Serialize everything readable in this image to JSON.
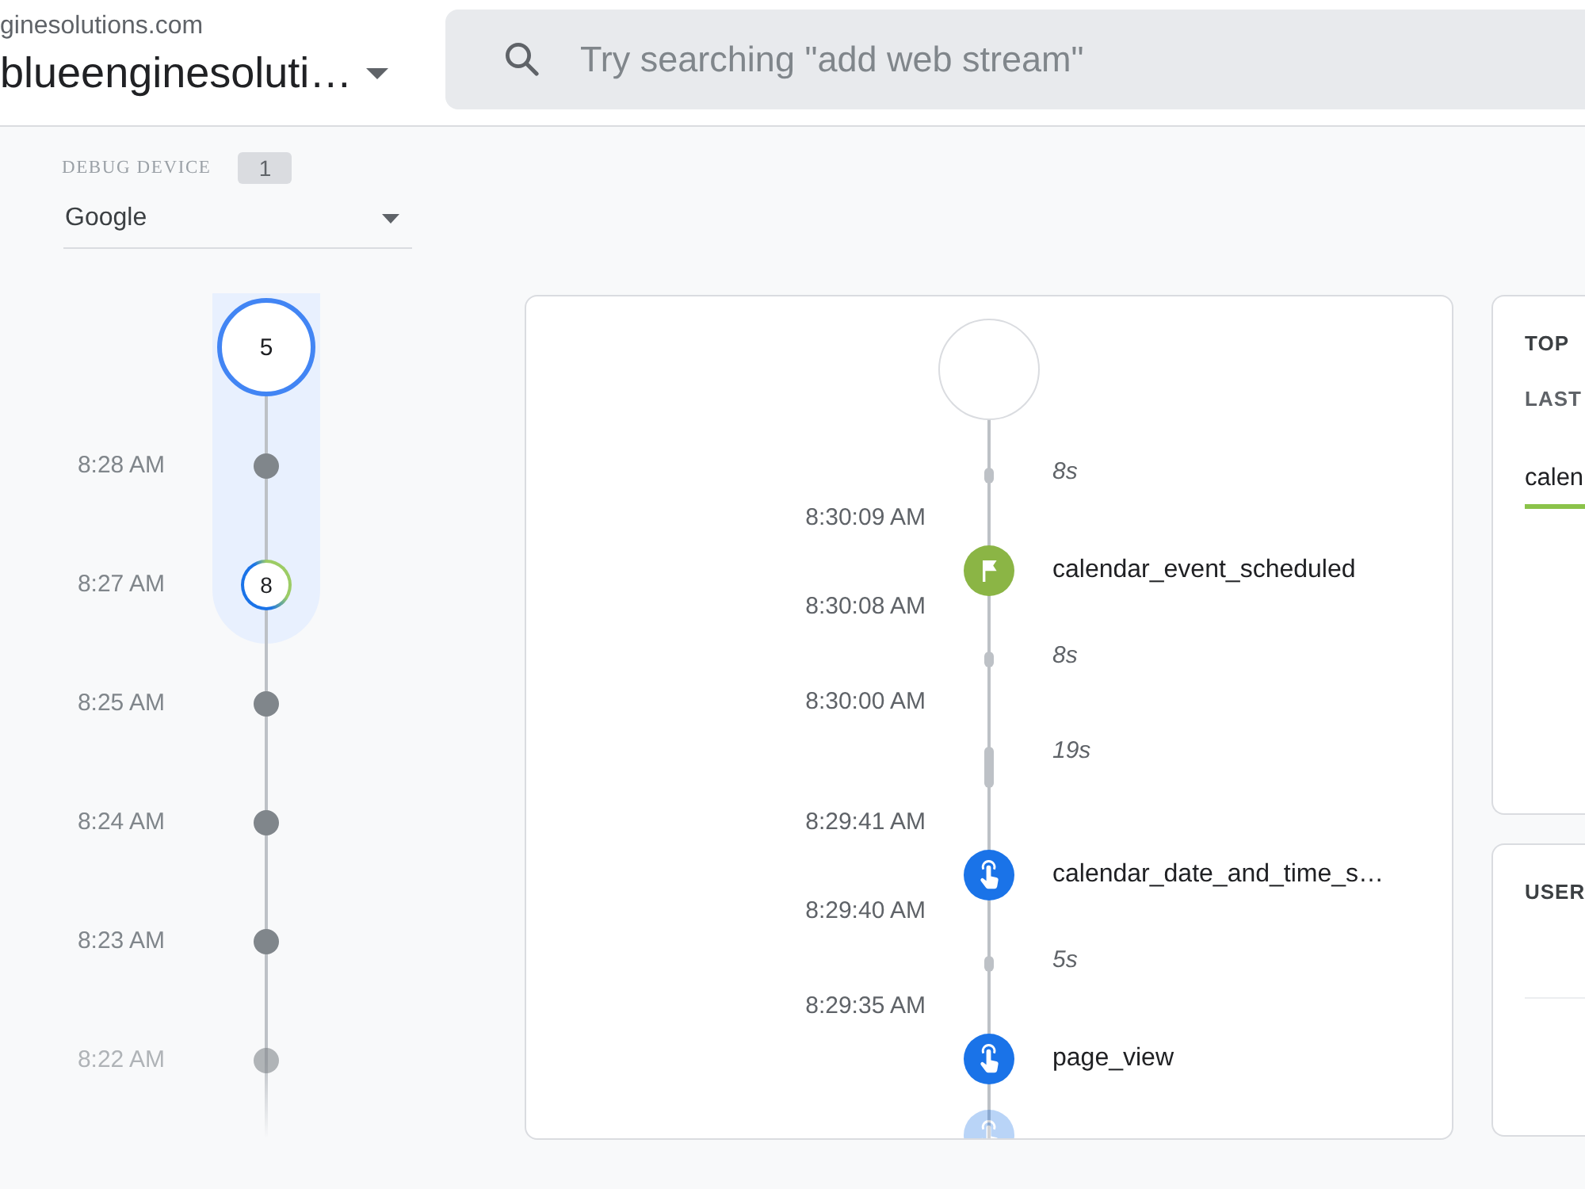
{
  "header": {
    "account": "ginesolutions.com",
    "property": "blueenginesoluti…",
    "search": {
      "placeholder": "Try searching \"add web stream\""
    }
  },
  "debug_device": {
    "label": "DEBUG DEVICE",
    "count": "1",
    "value": "Google"
  },
  "minute_stream": {
    "total": "5",
    "minutes": [
      {
        "time": "8:28 AM",
        "selected": true,
        "kind": "dot"
      },
      {
        "time": "8:27 AM",
        "selected": true,
        "kind": "count",
        "count": "8"
      },
      {
        "time": "8:25 AM",
        "selected": false,
        "kind": "dot"
      },
      {
        "time": "8:24 AM",
        "selected": false,
        "kind": "dot"
      },
      {
        "time": "8:23 AM",
        "selected": false,
        "kind": "dot"
      },
      {
        "time": "8:22 AM",
        "selected": false,
        "kind": "dot"
      }
    ]
  },
  "seconds_stream": {
    "items": [
      {
        "kind": "gap",
        "duration": "8s"
      },
      {
        "kind": "time",
        "time": "8:30:09 AM"
      },
      {
        "kind": "event",
        "name": "calendar_event_scheduled",
        "conversion": true
      },
      {
        "kind": "time",
        "time": "8:30:08 AM"
      },
      {
        "kind": "gap",
        "duration": "8s"
      },
      {
        "kind": "time",
        "time": "8:30:00 AM"
      },
      {
        "kind": "long_gap",
        "duration": "19s"
      },
      {
        "kind": "time",
        "time": "8:29:41 AM"
      },
      {
        "kind": "event",
        "name": "calendar_date_and_time_s…",
        "conversion": false
      },
      {
        "kind": "time",
        "time": "8:29:40 AM"
      },
      {
        "kind": "gap",
        "duration": "5s"
      },
      {
        "kind": "time",
        "time": "8:29:35 AM"
      },
      {
        "kind": "event",
        "name": "page_view",
        "conversion": false
      },
      {
        "kind": "event",
        "conversion": false
      }
    ]
  },
  "side_cards": [
    {
      "title": "TOP",
      "subtitle": "LAST",
      "tabs": [
        {
          "label": "calen",
          "selected": true
        }
      ]
    },
    {
      "title": "USER"
    }
  ]
}
